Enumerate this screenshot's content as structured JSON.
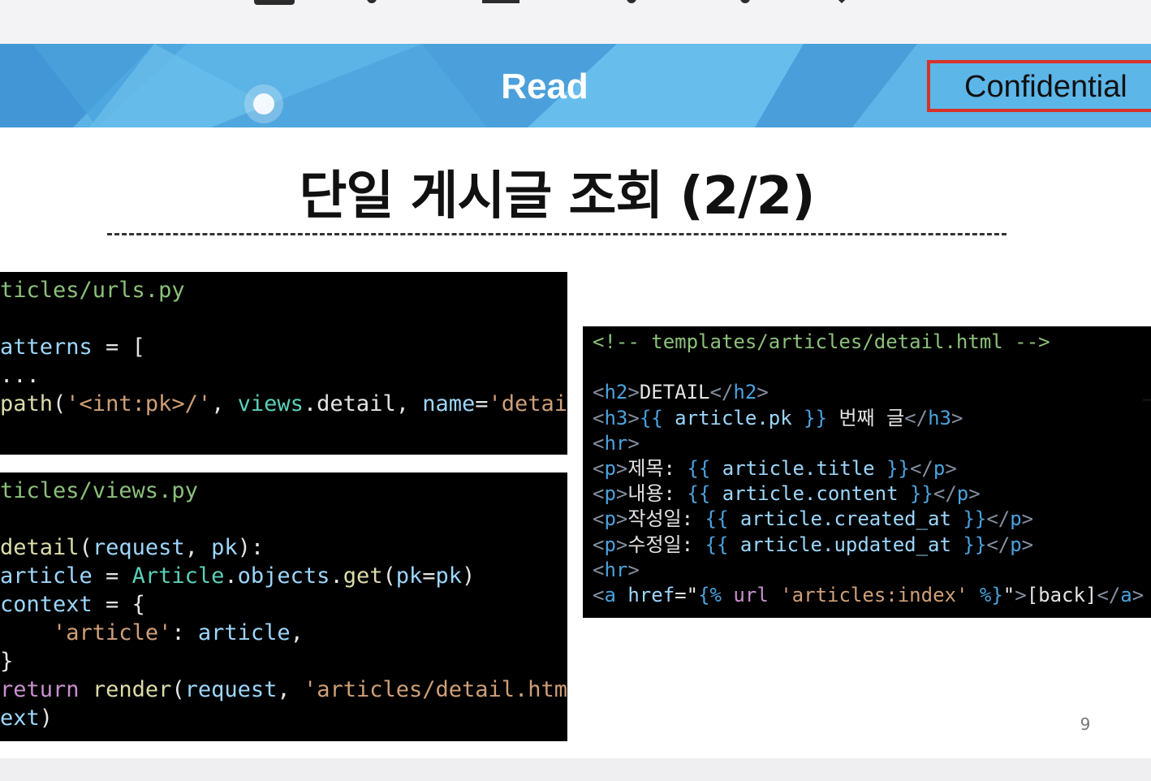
{
  "banner": {
    "title": "Read",
    "badge": "Confidential",
    "color": "#5cb3e6"
  },
  "slide": {
    "title": "단일 게시글 조회 (2/2)",
    "page_number": "9"
  },
  "code_urls": {
    "lines": [
      [
        {
          "t": "ticles/urls.py",
          "c": "cm"
        }
      ],
      [],
      [
        {
          "t": "atterns",
          "c": "vr"
        },
        {
          "t": " = [",
          "c": "pl"
        }
      ],
      [
        {
          "t": "...",
          "c": "pl"
        }
      ],
      [
        {
          "t": "path",
          "c": "fn"
        },
        {
          "t": "(",
          "c": "pl"
        },
        {
          "t": "'<int:pk>/'",
          "c": "st"
        },
        {
          "t": ", ",
          "c": "pl"
        },
        {
          "t": "views",
          "c": "cl"
        },
        {
          "t": ".detail, ",
          "c": "pl"
        },
        {
          "t": "name",
          "c": "vr"
        },
        {
          "t": "=",
          "c": "pl"
        },
        {
          "t": "'detail'",
          "c": "st"
        },
        {
          "t": "),",
          "c": "pl"
        }
      ]
    ]
  },
  "code_views": {
    "lines": [
      [
        {
          "t": "ticles/views.py",
          "c": "cm"
        }
      ],
      [],
      [
        {
          "t": "detail",
          "c": "fn"
        },
        {
          "t": "(",
          "c": "pl"
        },
        {
          "t": "request",
          "c": "vr"
        },
        {
          "t": ", ",
          "c": "pl"
        },
        {
          "t": "pk",
          "c": "vr"
        },
        {
          "t": "):",
          "c": "pl"
        }
      ],
      [
        {
          "t": "article",
          "c": "vr"
        },
        {
          "t": " = ",
          "c": "pl"
        },
        {
          "t": "Article",
          "c": "cl"
        },
        {
          "t": ".",
          "c": "pl"
        },
        {
          "t": "objects",
          "c": "vr"
        },
        {
          "t": ".",
          "c": "pl"
        },
        {
          "t": "get",
          "c": "fn"
        },
        {
          "t": "(",
          "c": "pl"
        },
        {
          "t": "pk",
          "c": "vr"
        },
        {
          "t": "=",
          "c": "pl"
        },
        {
          "t": "pk",
          "c": "vr"
        },
        {
          "t": ")",
          "c": "pl"
        }
      ],
      [
        {
          "t": "context",
          "c": "vr"
        },
        {
          "t": " = {",
          "c": "pl"
        }
      ],
      [
        {
          "t": "    ",
          "c": "pl"
        },
        {
          "t": "'article'",
          "c": "st"
        },
        {
          "t": ": ",
          "c": "pl"
        },
        {
          "t": "article",
          "c": "vr"
        },
        {
          "t": ",",
          "c": "pl"
        }
      ],
      [
        {
          "t": "}",
          "c": "pl"
        }
      ],
      [
        {
          "t": "return",
          "c": "kw"
        },
        {
          "t": " ",
          "c": "pl"
        },
        {
          "t": "render",
          "c": "fn"
        },
        {
          "t": "(",
          "c": "pl"
        },
        {
          "t": "request",
          "c": "vr"
        },
        {
          "t": ", ",
          "c": "pl"
        },
        {
          "t": "'articles/detail.html'",
          "c": "st"
        },
        {
          "t": ",",
          "c": "pl"
        }
      ],
      [
        {
          "t": "ext",
          "c": "vr"
        },
        {
          "t": ")",
          "c": "pl"
        }
      ]
    ]
  },
  "code_detail": {
    "lines": [
      [
        {
          "t": "<!-- templates/articles/detail.html -->",
          "c": "cm"
        }
      ],
      [],
      [
        {
          "t": "<",
          "c": "tg"
        },
        {
          "t": "h2",
          "c": "tt"
        },
        {
          "t": ">",
          "c": "tg"
        },
        {
          "t": "DETAIL",
          "c": "pl"
        },
        {
          "t": "</",
          "c": "tg"
        },
        {
          "t": "h2",
          "c": "tt"
        },
        {
          "t": ">",
          "c": "tg"
        }
      ],
      [
        {
          "t": "<",
          "c": "tg"
        },
        {
          "t": "h3",
          "c": "tt"
        },
        {
          "t": ">",
          "c": "tg"
        },
        {
          "t": "{{ ",
          "c": "tt"
        },
        {
          "t": "article.pk",
          "c": "vr"
        },
        {
          "t": " }}",
          "c": "tt"
        },
        {
          "t": " 번째 글",
          "c": "pl"
        },
        {
          "t": "</",
          "c": "tg"
        },
        {
          "t": "h3",
          "c": "tt"
        },
        {
          "t": ">",
          "c": "tg"
        }
      ],
      [
        {
          "t": "<",
          "c": "tg"
        },
        {
          "t": "hr",
          "c": "tt"
        },
        {
          "t": ">",
          "c": "tg"
        }
      ],
      [
        {
          "t": "<",
          "c": "tg"
        },
        {
          "t": "p",
          "c": "tt"
        },
        {
          "t": ">",
          "c": "tg"
        },
        {
          "t": "제목: ",
          "c": "pl"
        },
        {
          "t": "{{ ",
          "c": "tt"
        },
        {
          "t": "article.title",
          "c": "vr"
        },
        {
          "t": " }}",
          "c": "tt"
        },
        {
          "t": "</",
          "c": "tg"
        },
        {
          "t": "p",
          "c": "tt"
        },
        {
          "t": ">",
          "c": "tg"
        }
      ],
      [
        {
          "t": "<",
          "c": "tg"
        },
        {
          "t": "p",
          "c": "tt"
        },
        {
          "t": ">",
          "c": "tg"
        },
        {
          "t": "내용: ",
          "c": "pl"
        },
        {
          "t": "{{ ",
          "c": "tt"
        },
        {
          "t": "article.content",
          "c": "vr"
        },
        {
          "t": " }}",
          "c": "tt"
        },
        {
          "t": "</",
          "c": "tg"
        },
        {
          "t": "p",
          "c": "tt"
        },
        {
          "t": ">",
          "c": "tg"
        }
      ],
      [
        {
          "t": "<",
          "c": "tg"
        },
        {
          "t": "p",
          "c": "tt"
        },
        {
          "t": ">",
          "c": "tg"
        },
        {
          "t": "작성일: ",
          "c": "pl"
        },
        {
          "t": "{{ ",
          "c": "tt"
        },
        {
          "t": "article.created_at",
          "c": "vr"
        },
        {
          "t": " }}",
          "c": "tt"
        },
        {
          "t": "</",
          "c": "tg"
        },
        {
          "t": "p",
          "c": "tt"
        },
        {
          "t": ">",
          "c": "tg"
        }
      ],
      [
        {
          "t": "<",
          "c": "tg"
        },
        {
          "t": "p",
          "c": "tt"
        },
        {
          "t": ">",
          "c": "tg"
        },
        {
          "t": "수정일: ",
          "c": "pl"
        },
        {
          "t": "{{ ",
          "c": "tt"
        },
        {
          "t": "article.updated_at",
          "c": "vr"
        },
        {
          "t": " }}",
          "c": "tt"
        },
        {
          "t": "</",
          "c": "tg"
        },
        {
          "t": "p",
          "c": "tt"
        },
        {
          "t": ">",
          "c": "tg"
        }
      ],
      [
        {
          "t": "<",
          "c": "tg"
        },
        {
          "t": "hr",
          "c": "tt"
        },
        {
          "t": ">",
          "c": "tg"
        }
      ],
      [
        {
          "t": "<",
          "c": "tg"
        },
        {
          "t": "a",
          "c": "tt"
        },
        {
          "t": " ",
          "c": "pl"
        },
        {
          "t": "href",
          "c": "vr"
        },
        {
          "t": "=\"",
          "c": "pl"
        },
        {
          "t": "{%",
          "c": "tt"
        },
        {
          "t": " ",
          "c": "pl"
        },
        {
          "t": "url",
          "c": "kw"
        },
        {
          "t": " ",
          "c": "pl"
        },
        {
          "t": "'articles:index'",
          "c": "st"
        },
        {
          "t": " ",
          "c": "pl"
        },
        {
          "t": "%}",
          "c": "tt"
        },
        {
          "t": "\"",
          "c": "pl"
        },
        {
          "t": ">",
          "c": "tg"
        },
        {
          "t": "[back]",
          "c": "pl"
        },
        {
          "t": "</",
          "c": "tg"
        },
        {
          "t": "a",
          "c": "tt"
        },
        {
          "t": ">",
          "c": "tg"
        }
      ]
    ]
  }
}
